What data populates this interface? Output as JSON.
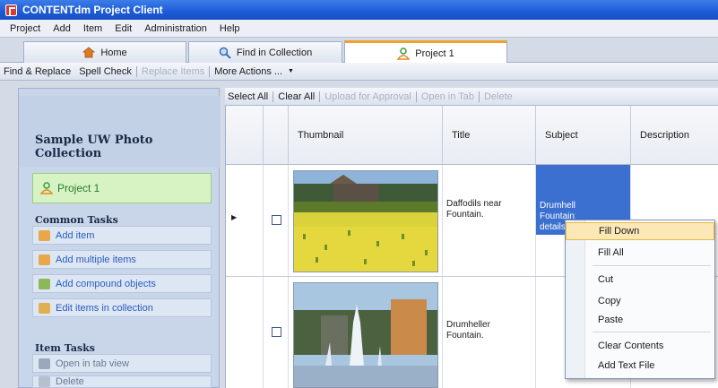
{
  "window": {
    "title": "CONTENTdm Project Client"
  },
  "menu": [
    "Project",
    "Add",
    "Item",
    "Edit",
    "Administration",
    "Help"
  ],
  "tabs": [
    {
      "label": "Home",
      "icon": "home-icon"
    },
    {
      "label": "Find in Collection",
      "icon": "magnifier-icon"
    },
    {
      "label": "Project 1",
      "icon": "project-person-icon"
    }
  ],
  "toolbar": {
    "find_replace": "Find & Replace",
    "spell_check": "Spell Check",
    "replace_items": "Replace Items",
    "more_actions": "More Actions ...",
    "more_arrow": "▼"
  },
  "sidebar": {
    "collection_title": "Sample UW Photo Collection",
    "project_label": "Project 1",
    "common_tasks_heading": "Common Tasks",
    "common_tasks": [
      "Add item",
      "Add multiple items",
      "Add compound objects",
      "Edit items in collection"
    ],
    "item_tasks_heading": "Item Tasks",
    "item_tasks": [
      "Open in tab view",
      "Delete"
    ]
  },
  "grid_toolbar": {
    "select_all": "Select All",
    "clear_all": "Clear All",
    "upload": "Upload for Approval",
    "open_in_tab": "Open in Tab",
    "delete": "Delete"
  },
  "grid": {
    "columns": [
      "Thumbnail",
      "Title",
      "Subject",
      "Description"
    ],
    "rows": [
      {
        "title": "Daffodils near Fountain.",
        "subject": "Drumheller Fountain; details"
      },
      {
        "title": "Drumheller Fountain.",
        "subject": ""
      }
    ],
    "row_indicator": "▶"
  },
  "context_menu": {
    "items": [
      "Fill Down",
      "Fill All",
      "Cut",
      "Copy",
      "Paste",
      "Clear Contents",
      "Add Text File"
    ],
    "highlighted": "Fill Down"
  },
  "colors": {
    "titlebar": "#1c5bd6",
    "selection": "#3b6fd0",
    "highlight": "#fbe8b6",
    "project_green": "#d7f3c4"
  }
}
